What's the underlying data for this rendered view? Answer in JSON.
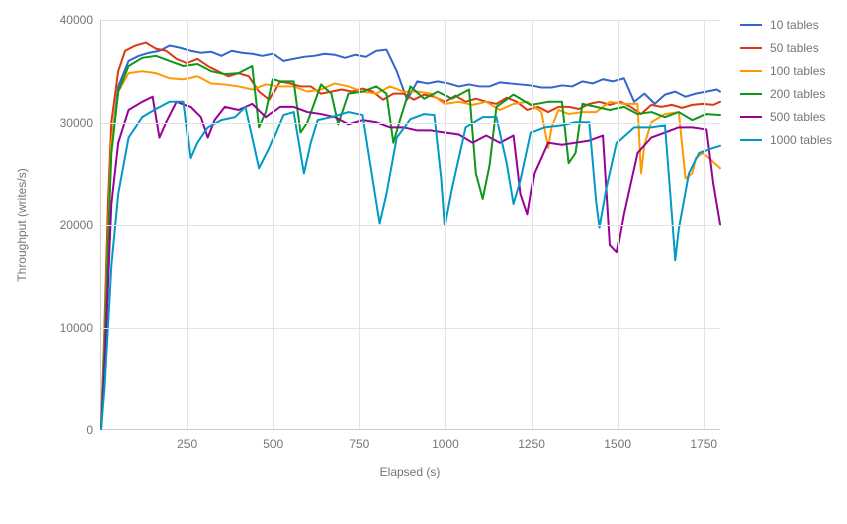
{
  "chart_data": {
    "type": "line",
    "title": "",
    "xlabel": "Elapsed (s)",
    "ylabel": "Throughput (writes/s)",
    "xlim": [
      0,
      1800
    ],
    "ylim": [
      0,
      40000
    ],
    "xticks": [
      250,
      500,
      750,
      1000,
      1250,
      1500,
      1750
    ],
    "yticks": [
      0,
      10000,
      20000,
      30000,
      40000
    ],
    "grid": true,
    "legend_position": "right",
    "series": [
      {
        "name": "10 tables",
        "color": "#3366CC",
        "x": [
          0,
          10,
          20,
          30,
          50,
          80,
          110,
          140,
          170,
          200,
          230,
          260,
          290,
          320,
          350,
          380,
          410,
          440,
          470,
          500,
          530,
          560,
          590,
          620,
          650,
          680,
          710,
          740,
          770,
          800,
          830,
          860,
          890,
          920,
          950,
          980,
          1010,
          1040,
          1070,
          1100,
          1130,
          1160,
          1190,
          1220,
          1250,
          1280,
          1310,
          1340,
          1370,
          1400,
          1430,
          1460,
          1490,
          1520,
          1550,
          1580,
          1610,
          1640,
          1670,
          1700,
          1730,
          1760,
          1790,
          1800
        ],
        "y": [
          0,
          8000,
          18000,
          28000,
          33500,
          36000,
          36500,
          36800,
          37000,
          37500,
          37300,
          37000,
          36800,
          36900,
          36500,
          37000,
          36800,
          36700,
          36500,
          36700,
          36000,
          36200,
          36400,
          36500,
          36700,
          36600,
          36300,
          36600,
          36400,
          37000,
          37100,
          35000,
          32200,
          34000,
          33800,
          34000,
          33800,
          33500,
          33700,
          33500,
          33500,
          33900,
          33800,
          33700,
          33600,
          33400,
          33400,
          33600,
          33500,
          34000,
          33800,
          34200,
          34000,
          34300,
          32000,
          32800,
          31800,
          32700,
          33000,
          32500,
          32800,
          33000,
          33200,
          33000
        ]
      },
      {
        "name": "50 tables",
        "color": "#DC3912",
        "x": [
          0,
          10,
          20,
          30,
          50,
          70,
          100,
          130,
          160,
          190,
          220,
          250,
          280,
          310,
          340,
          370,
          400,
          430,
          460,
          490,
          520,
          550,
          580,
          610,
          640,
          670,
          700,
          730,
          760,
          790,
          820,
          850,
          880,
          910,
          940,
          970,
          1000,
          1030,
          1060,
          1090,
          1120,
          1150,
          1180,
          1210,
          1240,
          1270,
          1300,
          1330,
          1360,
          1390,
          1420,
          1450,
          1480,
          1510,
          1540,
          1570,
          1600,
          1630,
          1660,
          1690,
          1720,
          1750,
          1780,
          1800
        ],
        "y": [
          0,
          10000,
          22000,
          30000,
          35000,
          37000,
          37500,
          37800,
          37200,
          37000,
          36200,
          35800,
          36200,
          35500,
          35000,
          34500,
          34800,
          34500,
          33000,
          32200,
          34000,
          33800,
          33500,
          33500,
          32800,
          33000,
          33200,
          33000,
          33300,
          33000,
          32200,
          32800,
          32800,
          32200,
          32700,
          32500,
          32000,
          32600,
          32000,
          32300,
          32000,
          31800,
          32400,
          32000,
          31200,
          31500,
          31000,
          31500,
          31500,
          31300,
          31800,
          32000,
          31700,
          32000,
          31500,
          30800,
          31700,
          31500,
          31700,
          31400,
          31700,
          31800,
          31700,
          32000
        ]
      },
      {
        "name": "100 tables",
        "color": "#FF9900",
        "x": [
          0,
          10,
          20,
          30,
          50,
          80,
          120,
          160,
          200,
          240,
          280,
          320,
          360,
          400,
          440,
          480,
          520,
          560,
          600,
          640,
          680,
          720,
          760,
          800,
          840,
          880,
          920,
          960,
          1000,
          1040,
          1080,
          1120,
          1160,
          1200,
          1240,
          1280,
          1300,
          1310,
          1330,
          1360,
          1400,
          1440,
          1480,
          1520,
          1560,
          1570,
          1580,
          1600,
          1640,
          1680,
          1700,
          1720,
          1730,
          1750,
          1800
        ],
        "y": [
          0,
          9000,
          19000,
          28000,
          33000,
          34800,
          35000,
          34800,
          34300,
          34200,
          34500,
          33800,
          33700,
          33500,
          33200,
          33700,
          33500,
          33500,
          33000,
          33200,
          33800,
          33500,
          33000,
          32800,
          33500,
          33000,
          33000,
          32800,
          31800,
          32000,
          31700,
          32000,
          31200,
          31800,
          32000,
          31000,
          27500,
          29500,
          31200,
          30800,
          31000,
          31000,
          32000,
          31800,
          31800,
          25000,
          27800,
          30000,
          30800,
          31000,
          24500,
          25000,
          26500,
          27000,
          25500
        ]
      },
      {
        "name": "200 tables",
        "color": "#109618",
        "x": [
          0,
          10,
          20,
          30,
          50,
          80,
          120,
          160,
          200,
          240,
          280,
          320,
          360,
          400,
          440,
          460,
          480,
          500,
          520,
          560,
          580,
          600,
          640,
          670,
          690,
          720,
          760,
          800,
          830,
          850,
          870,
          900,
          940,
          980,
          1020,
          1070,
          1090,
          1110,
          1130,
          1150,
          1200,
          1250,
          1300,
          1340,
          1360,
          1380,
          1400,
          1440,
          1480,
          1520,
          1560,
          1600,
          1640,
          1680,
          1720,
          1760,
          1800
        ],
        "y": [
          0,
          8000,
          18000,
          27000,
          33000,
          35500,
          36300,
          36500,
          36000,
          35500,
          35700,
          35000,
          34700,
          34800,
          35500,
          29500,
          31000,
          34200,
          34000,
          34000,
          29000,
          30000,
          33700,
          32800,
          29800,
          32800,
          33000,
          33500,
          32800,
          28000,
          30300,
          33500,
          32300,
          33000,
          32300,
          33200,
          25000,
          22500,
          25800,
          31500,
          32700,
          31700,
          32000,
          32000,
          26000,
          27000,
          31800,
          31500,
          31200,
          31500,
          30800,
          31000,
          30500,
          31000,
          30200,
          30800,
          30700
        ]
      },
      {
        "name": "500 tables",
        "color": "#990099",
        "x": [
          0,
          10,
          20,
          30,
          50,
          80,
          120,
          150,
          170,
          190,
          220,
          260,
          290,
          310,
          330,
          360,
          400,
          440,
          480,
          520,
          560,
          600,
          640,
          680,
          720,
          760,
          800,
          840,
          880,
          920,
          960,
          1000,
          1040,
          1080,
          1120,
          1160,
          1200,
          1220,
          1240,
          1260,
          1300,
          1340,
          1380,
          1420,
          1460,
          1480,
          1500,
          1520,
          1560,
          1600,
          1640,
          1680,
          1720,
          1760,
          1780,
          1800
        ],
        "y": [
          0,
          6000,
          14000,
          22000,
          28000,
          31200,
          32000,
          32500,
          28500,
          30000,
          32000,
          31500,
          30500,
          28500,
          30200,
          31500,
          31200,
          31800,
          30500,
          31500,
          31500,
          31000,
          30800,
          30500,
          29800,
          30200,
          30000,
          29500,
          29500,
          29200,
          29200,
          29000,
          28800,
          28000,
          28700,
          28000,
          28700,
          23000,
          21000,
          25000,
          28000,
          27800,
          28000,
          28200,
          28700,
          18000,
          17300,
          21000,
          27000,
          28500,
          29000,
          29500,
          29500,
          29300,
          24000,
          20000
        ]
      },
      {
        "name": "1000 tables",
        "color": "#0099C6",
        "x": [
          0,
          10,
          20,
          30,
          50,
          80,
          120,
          160,
          200,
          240,
          260,
          280,
          310,
          350,
          390,
          420,
          440,
          460,
          490,
          530,
          560,
          580,
          590,
          610,
          630,
          670,
          720,
          760,
          790,
          810,
          830,
          860,
          900,
          940,
          970,
          990,
          1000,
          1020,
          1060,
          1110,
          1150,
          1180,
          1200,
          1220,
          1250,
          1290,
          1340,
          1380,
          1420,
          1440,
          1450,
          1470,
          1500,
          1550,
          1600,
          1640,
          1660,
          1670,
          1680,
          1710,
          1740,
          1780,
          1800
        ],
        "y": [
          0,
          4000,
          10000,
          16000,
          23000,
          28500,
          30500,
          31300,
          32000,
          32000,
          26500,
          28000,
          29500,
          30200,
          30500,
          31500,
          28500,
          25500,
          27500,
          30700,
          31000,
          27000,
          25000,
          28000,
          30200,
          30500,
          31000,
          30700,
          24300,
          20100,
          23000,
          28500,
          30300,
          30800,
          30700,
          24500,
          20000,
          23500,
          29500,
          30500,
          30500,
          26000,
          22000,
          24300,
          29000,
          29500,
          29700,
          30000,
          30000,
          22300,
          19700,
          23500,
          28000,
          29500,
          29500,
          29700,
          21000,
          16500,
          19500,
          25000,
          27000,
          27500,
          27700
        ]
      }
    ]
  }
}
